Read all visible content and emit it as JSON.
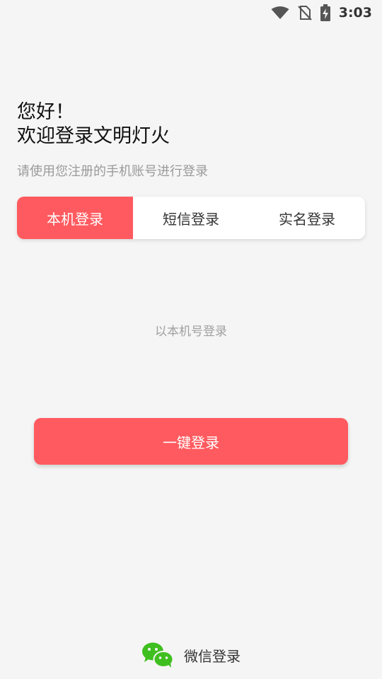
{
  "status_bar": {
    "time": "3:03",
    "icons": [
      "wifi-icon",
      "no-sim-icon",
      "battery-charging-icon"
    ]
  },
  "greeting": {
    "line1": "您好！",
    "line2": "欢迎登录文明灯火"
  },
  "subtitle": "请使用您注册的手机账号进行登录",
  "tabs": [
    {
      "label": "本机登录",
      "active": true
    },
    {
      "label": "短信登录",
      "active": false
    },
    {
      "label": "实名登录",
      "active": false
    }
  ],
  "hint": "以本机号登录",
  "login_button": "一键登录",
  "wechat_login": {
    "label": "微信登录",
    "icon": "wechat-icon"
  },
  "colors": {
    "accent": "#ff5a5f",
    "wechat": "#3fbf1f",
    "background": "#f5f5f5"
  }
}
